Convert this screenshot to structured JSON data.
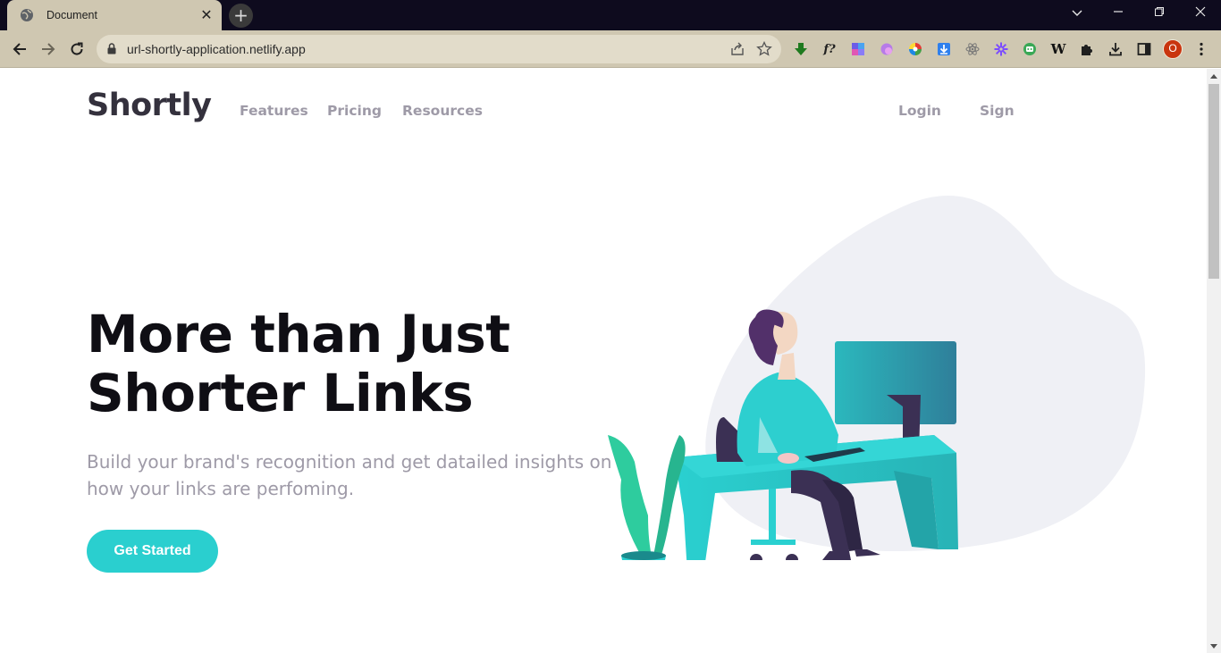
{
  "browser": {
    "tab_title": "Document",
    "url": "url-shortly-application.netlify.app",
    "profile_initial": "O",
    "extensions": [
      "download-arrow-icon",
      "function-icon",
      "palette-icon",
      "blob-icon",
      "color-wheel-icon",
      "download-box-icon",
      "react-icon",
      "gear-flower-icon",
      "robot-icon",
      "wikipedia-icon",
      "puzzle-icon"
    ],
    "wiki_glyph": "W",
    "fx_glyph": "f?"
  },
  "site": {
    "logo": "Shortly",
    "nav": {
      "features": "Features",
      "pricing": "Pricing",
      "resources": "Resources",
      "login": "Login",
      "sign": "Sign"
    },
    "hero": {
      "title_line1": "More than Just",
      "title_line2": "Shorter Links",
      "subtitle": "Build your brand's recognition and get datailed insights on how your links are perfoming.",
      "cta": "Get Started"
    }
  },
  "colors": {
    "accent": "#2acfcf",
    "text_dark": "#34313d",
    "text_muted": "#9e9aa7",
    "chrome": "#cfc7b1"
  }
}
